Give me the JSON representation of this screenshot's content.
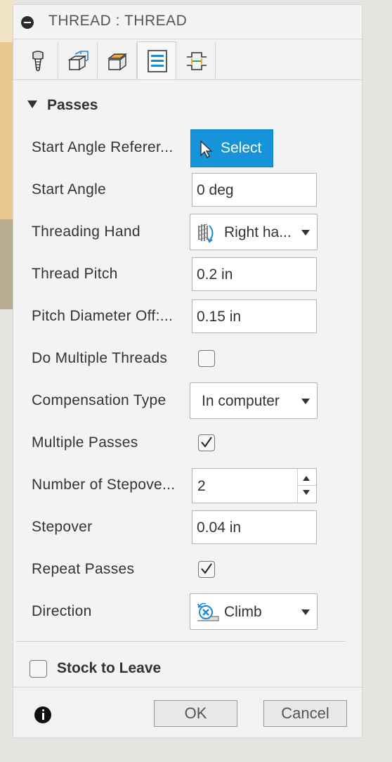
{
  "dialog": {
    "title": "THREAD : THREAD"
  },
  "tabs": [
    {
      "icon": "tool-icon"
    },
    {
      "icon": "geometry-icon"
    },
    {
      "icon": "heights-icon"
    },
    {
      "icon": "passes-icon",
      "active": true
    },
    {
      "icon": "linking-icon"
    }
  ],
  "passes": {
    "section_label": "Passes",
    "start_angle_reference_label": "Start Angle Referer...",
    "select_button_label": "Select",
    "start_angle_label": "Start Angle",
    "start_angle_value": "0 deg",
    "threading_hand_label": "Threading Hand",
    "threading_hand_value": "Right ha...",
    "thread_pitch_label": "Thread Pitch",
    "thread_pitch_value": "0.2 in",
    "pitch_diameter_offset_label": "Pitch Diameter Off:...",
    "pitch_diameter_offset_value": "0.15 in",
    "do_multiple_threads_label": "Do Multiple Threads",
    "do_multiple_threads_checked": false,
    "compensation_type_label": "Compensation Type",
    "compensation_type_value": "In computer",
    "multiple_passes_label": "Multiple Passes",
    "multiple_passes_checked": true,
    "number_of_stepovers_label": "Number of Stepove...",
    "number_of_stepovers_value": "2",
    "stepover_label": "Stepover",
    "stepover_value": "0.04 in",
    "repeat_passes_label": "Repeat Passes",
    "repeat_passes_checked": true,
    "direction_label": "Direction",
    "direction_value": "Climb"
  },
  "stock_to_leave": {
    "label": "Stock to Leave",
    "checked": false
  },
  "footer": {
    "ok_label": "OK",
    "cancel_label": "Cancel"
  },
  "colors": {
    "accent": "#1793d9"
  }
}
